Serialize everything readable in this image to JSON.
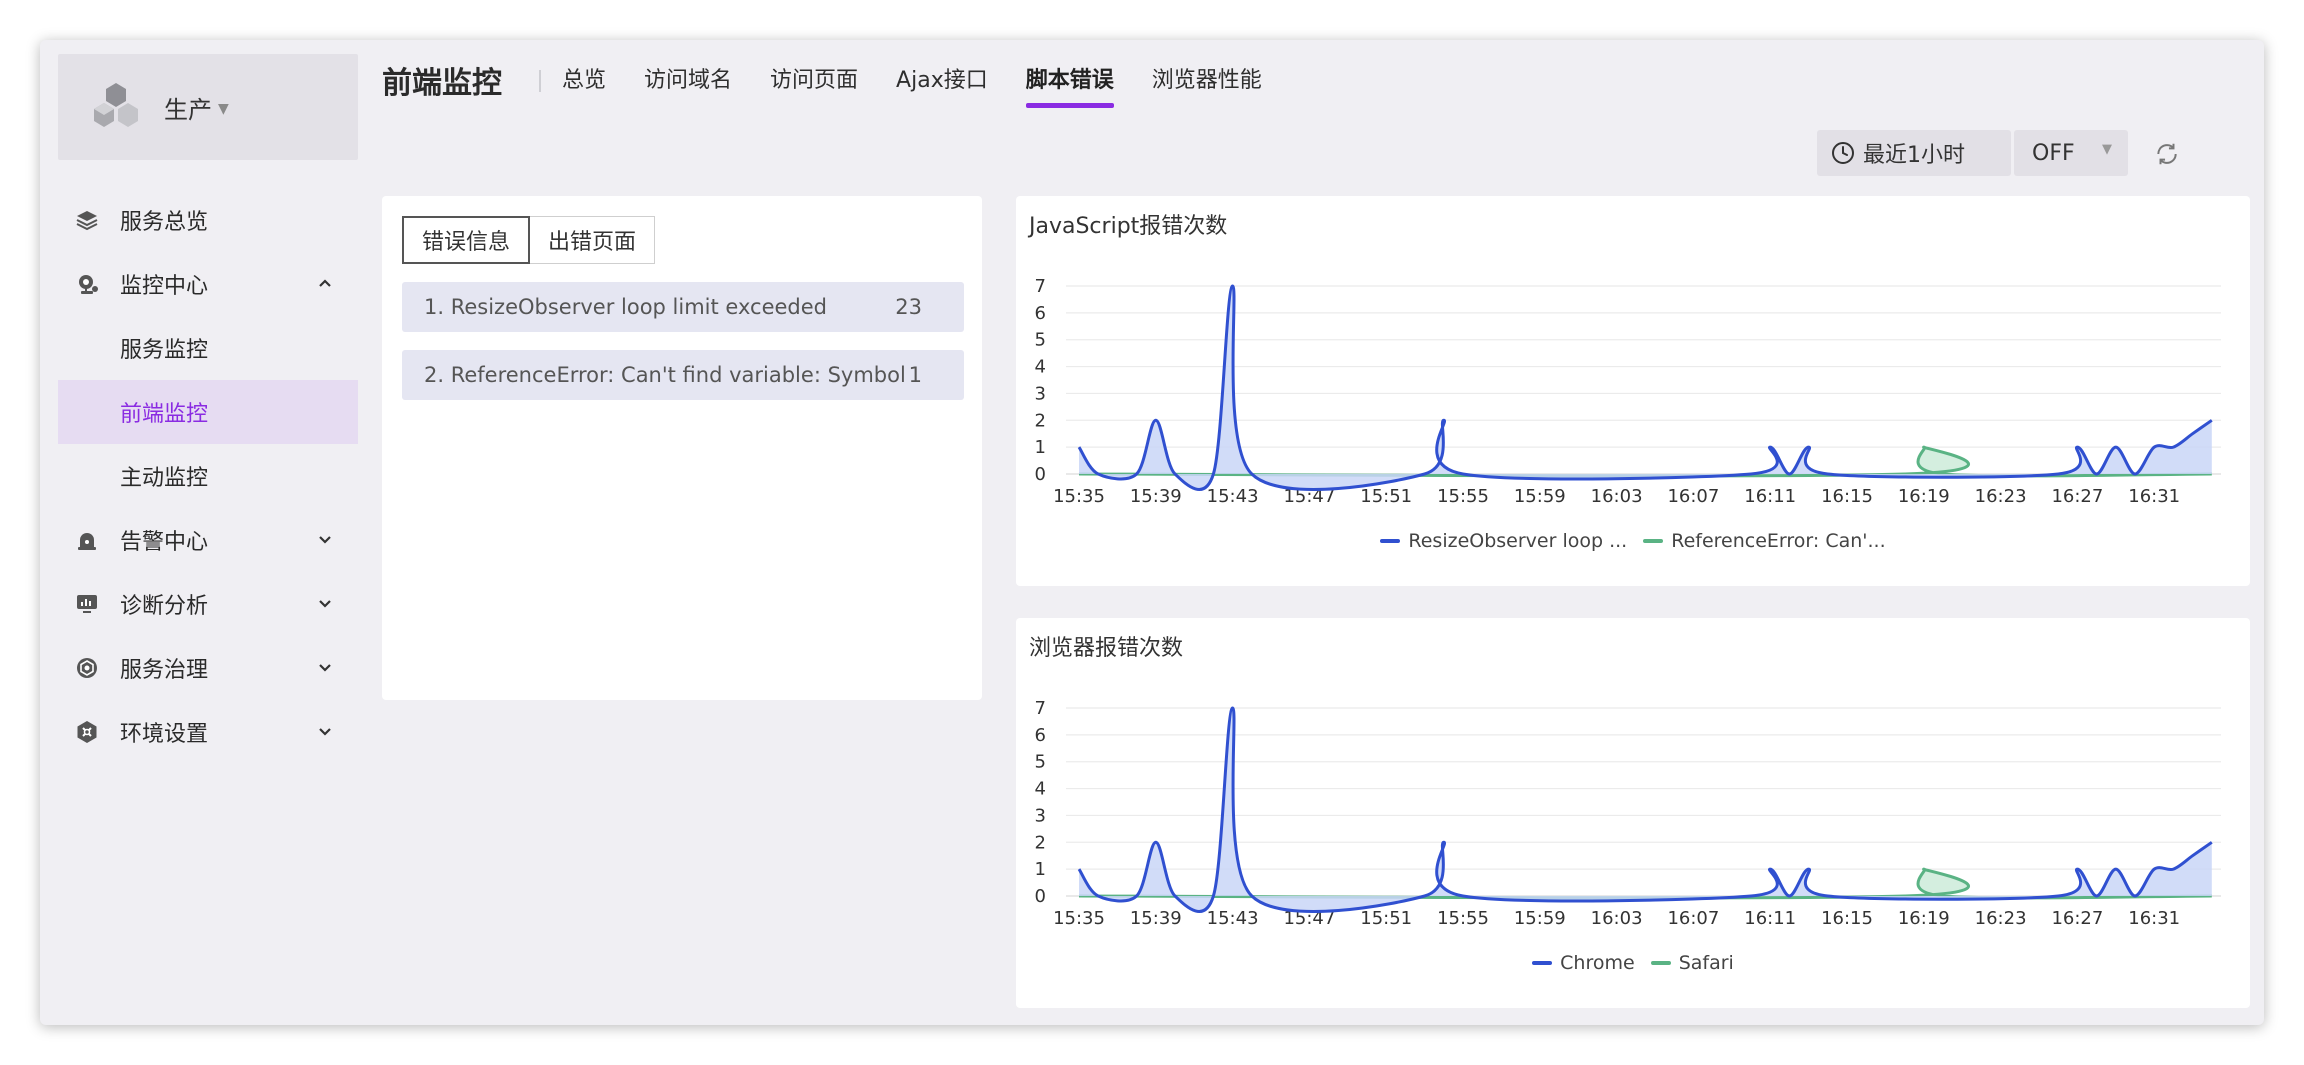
{
  "sidebar": {
    "env_label": "生产",
    "items": [
      {
        "label": "服务总览",
        "icon": "layers-icon",
        "type": "top",
        "chevron": ""
      },
      {
        "label": "监控中心",
        "icon": "webcam-icon",
        "type": "top",
        "chevron": "up"
      },
      {
        "label": "服务监控",
        "icon": "",
        "type": "sub",
        "chevron": ""
      },
      {
        "label": "前端监控",
        "icon": "",
        "type": "sub",
        "chevron": "",
        "active": true
      },
      {
        "label": "主动监控",
        "icon": "",
        "type": "sub",
        "chevron": ""
      },
      {
        "label": "告警中心",
        "icon": "alarm-icon",
        "type": "top",
        "chevron": "down"
      },
      {
        "label": "诊断分析",
        "icon": "monitor-icon",
        "type": "top",
        "chevron": "down"
      },
      {
        "label": "服务治理",
        "icon": "governance-icon",
        "type": "top",
        "chevron": "down"
      },
      {
        "label": "环境设置",
        "icon": "settings-icon",
        "type": "top",
        "chevron": "down"
      }
    ]
  },
  "header": {
    "title": "前端监控",
    "tabs": [
      {
        "label": "总览",
        "active": false
      },
      {
        "label": "访问域名",
        "active": false
      },
      {
        "label": "访问页面",
        "active": false
      },
      {
        "label": "Ajax接口",
        "active": false
      },
      {
        "label": "脚本错误",
        "active": true
      },
      {
        "label": "浏览器性能",
        "active": false
      }
    ],
    "time_range": "最近1小时",
    "auto_refresh": "OFF"
  },
  "error_panel": {
    "tabs": [
      {
        "label": "错误信息",
        "active": true
      },
      {
        "label": "出错页面",
        "active": false
      }
    ],
    "errors": [
      {
        "text": "1. ResizeObserver loop limit exceeded",
        "count": "23"
      },
      {
        "text": "2. ReferenceError: Can't find variable: Symbol",
        "count": "1"
      }
    ]
  },
  "colors": {
    "accent": "#8a2be2",
    "series_blue": "#3050d0",
    "series_blue_fill": "#c9d6f7",
    "series_green": "#5ab384",
    "series_green_fill": "#cdebd9"
  },
  "chart_data": [
    {
      "type": "area",
      "title": "JavaScript报错次数",
      "x_ticks": [
        "15:35",
        "15:39",
        "15:43",
        "15:47",
        "15:51",
        "15:55",
        "15:59",
        "16:03",
        "16:07",
        "16:11",
        "16:15",
        "16:19",
        "16:23",
        "16:27",
        "16:31"
      ],
      "x_range_minutes": [
        0,
        59
      ],
      "ylim": [
        0,
        7
      ],
      "y_ticks": [
        0,
        1,
        2,
        3,
        4,
        5,
        6,
        7
      ],
      "grid": true,
      "legend_position": "bottom",
      "series": [
        {
          "name": "ResizeObserver loop ...",
          "color": "#3050d0",
          "points": [
            [
              0,
              1
            ],
            [
              1,
              0
            ],
            [
              3,
              0
            ],
            [
              4,
              2
            ],
            [
              5,
              0
            ],
            [
              7,
              0
            ],
            [
              8,
              7
            ],
            [
              9,
              0
            ],
            [
              18,
              0
            ],
            [
              19,
              2
            ],
            [
              20,
              0
            ],
            [
              35,
              0
            ],
            [
              36,
              1
            ],
            [
              37,
              0
            ],
            [
              38,
              1
            ],
            [
              39,
              0
            ],
            [
              51,
              0
            ],
            [
              52,
              1
            ],
            [
              53,
              0
            ],
            [
              54,
              1
            ],
            [
              55,
              0
            ],
            [
              56,
              1
            ],
            [
              57,
              1
            ],
            [
              58,
              1.5
            ],
            [
              59,
              2
            ]
          ]
        },
        {
          "name": "ReferenceError: Can'...",
          "color": "#5ab384",
          "points": [
            [
              0,
              0
            ],
            [
              43,
              0
            ],
            [
              44,
              1
            ],
            [
              45,
              0
            ],
            [
              59,
              0
            ]
          ]
        }
      ]
    },
    {
      "type": "area",
      "title": "浏览器报错次数",
      "x_ticks": [
        "15:35",
        "15:39",
        "15:43",
        "15:47",
        "15:51",
        "15:55",
        "15:59",
        "16:03",
        "16:07",
        "16:11",
        "16:15",
        "16:19",
        "16:23",
        "16:27",
        "16:31"
      ],
      "x_range_minutes": [
        0,
        59
      ],
      "ylim": [
        0,
        7
      ],
      "y_ticks": [
        0,
        1,
        2,
        3,
        4,
        5,
        6,
        7
      ],
      "grid": true,
      "legend_position": "bottom",
      "series": [
        {
          "name": "Chrome",
          "color": "#3050d0",
          "points": [
            [
              0,
              1
            ],
            [
              1,
              0
            ],
            [
              3,
              0
            ],
            [
              4,
              2
            ],
            [
              5,
              0
            ],
            [
              7,
              0
            ],
            [
              8,
              7
            ],
            [
              9,
              0
            ],
            [
              18,
              0
            ],
            [
              19,
              2
            ],
            [
              20,
              0
            ],
            [
              35,
              0
            ],
            [
              36,
              1
            ],
            [
              37,
              0
            ],
            [
              38,
              1
            ],
            [
              39,
              0
            ],
            [
              51,
              0
            ],
            [
              52,
              1
            ],
            [
              53,
              0
            ],
            [
              54,
              1
            ],
            [
              55,
              0
            ],
            [
              56,
              1
            ],
            [
              57,
              1
            ],
            [
              58,
              1.5
            ],
            [
              59,
              2
            ]
          ]
        },
        {
          "name": "Safari",
          "color": "#5ab384",
          "points": [
            [
              0,
              0
            ],
            [
              43,
              0
            ],
            [
              44,
              1
            ],
            [
              45,
              0
            ],
            [
              59,
              0
            ]
          ]
        }
      ]
    }
  ]
}
